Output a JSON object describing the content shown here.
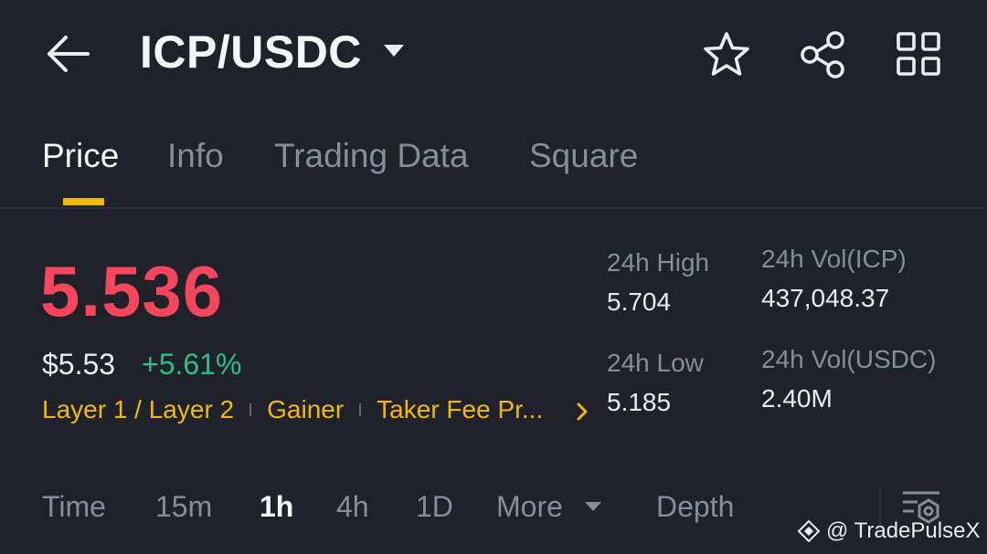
{
  "header": {
    "pair": "ICP/USDC"
  },
  "tabs": [
    {
      "label": "Price",
      "active": true
    },
    {
      "label": "Info",
      "active": false
    },
    {
      "label": "Trading Data",
      "active": false
    },
    {
      "label": "Square",
      "active": false
    }
  ],
  "price": {
    "last": "5.536",
    "fiat": "$5.53",
    "change": "+5.61%",
    "tags": [
      "Layer 1 / Layer 2",
      "Gainer",
      "Taker Fee Pr..."
    ]
  },
  "stats": {
    "high_label": "24h High",
    "high_value": "5.704",
    "low_label": "24h Low",
    "low_value": "5.185",
    "vol_base_label": "24h Vol(ICP)",
    "vol_base_value": "437,048.37",
    "vol_quote_label": "24h Vol(USDC)",
    "vol_quote_value": "2.40M"
  },
  "intervals": {
    "time": "Time",
    "m15": "15m",
    "h1": "1h",
    "h4": "4h",
    "d1": "1D",
    "more": "More",
    "depth": "Depth",
    "active": "1h"
  },
  "watermark": "@ TradePulseX",
  "colors": {
    "background": "#1f2229",
    "price_down_red": "#f6465d",
    "change_up_green": "#2ebd85",
    "accent_yellow": "#f0b90b",
    "muted_text": "#848e9c"
  }
}
